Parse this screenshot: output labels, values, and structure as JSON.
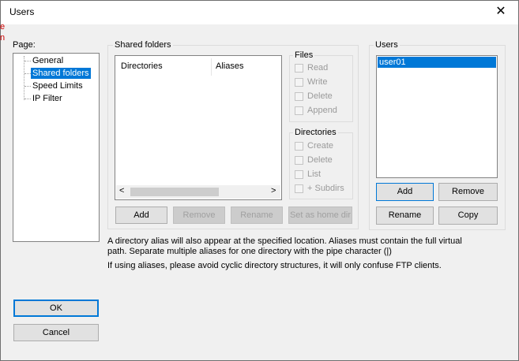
{
  "window": {
    "title": "Users"
  },
  "page_panel": {
    "label": "Page:",
    "items": [
      "General",
      "Shared folders",
      "Speed Limits",
      "IP Filter"
    ],
    "selected_index": 1
  },
  "shared_folders": {
    "label": "Shared folders",
    "columns": [
      "Directories",
      "Aliases"
    ],
    "buttons": {
      "add": "Add",
      "remove": "Remove",
      "rename": "Rename",
      "set_home": "Set as home dir"
    }
  },
  "files_group": {
    "label": "Files",
    "options": [
      "Read",
      "Write",
      "Delete",
      "Append"
    ]
  },
  "dirs_group": {
    "label": "Directories",
    "options": [
      "Create",
      "Delete",
      "List",
      "+ Subdirs"
    ]
  },
  "users_panel": {
    "label": "Users",
    "items": [
      "user01"
    ],
    "buttons": {
      "add": "Add",
      "remove": "Remove",
      "rename": "Rename",
      "copy": "Copy"
    }
  },
  "notes": {
    "line1": "A directory alias will also appear at the specified location. Aliases must contain the full virtual",
    "line2": "path. Separate multiple aliases for one directory with the pipe character (|)",
    "line3": "If using aliases, please avoid cyclic directory structures, it will only confuse FTP clients."
  },
  "footer": {
    "ok": "OK",
    "cancel": "Cancel"
  },
  "icons": {
    "close": "close-icon",
    "scroll_left": "chevron-left-icon",
    "scroll_right": "chevron-right-icon"
  },
  "colors": {
    "accent": "#0078d7"
  }
}
